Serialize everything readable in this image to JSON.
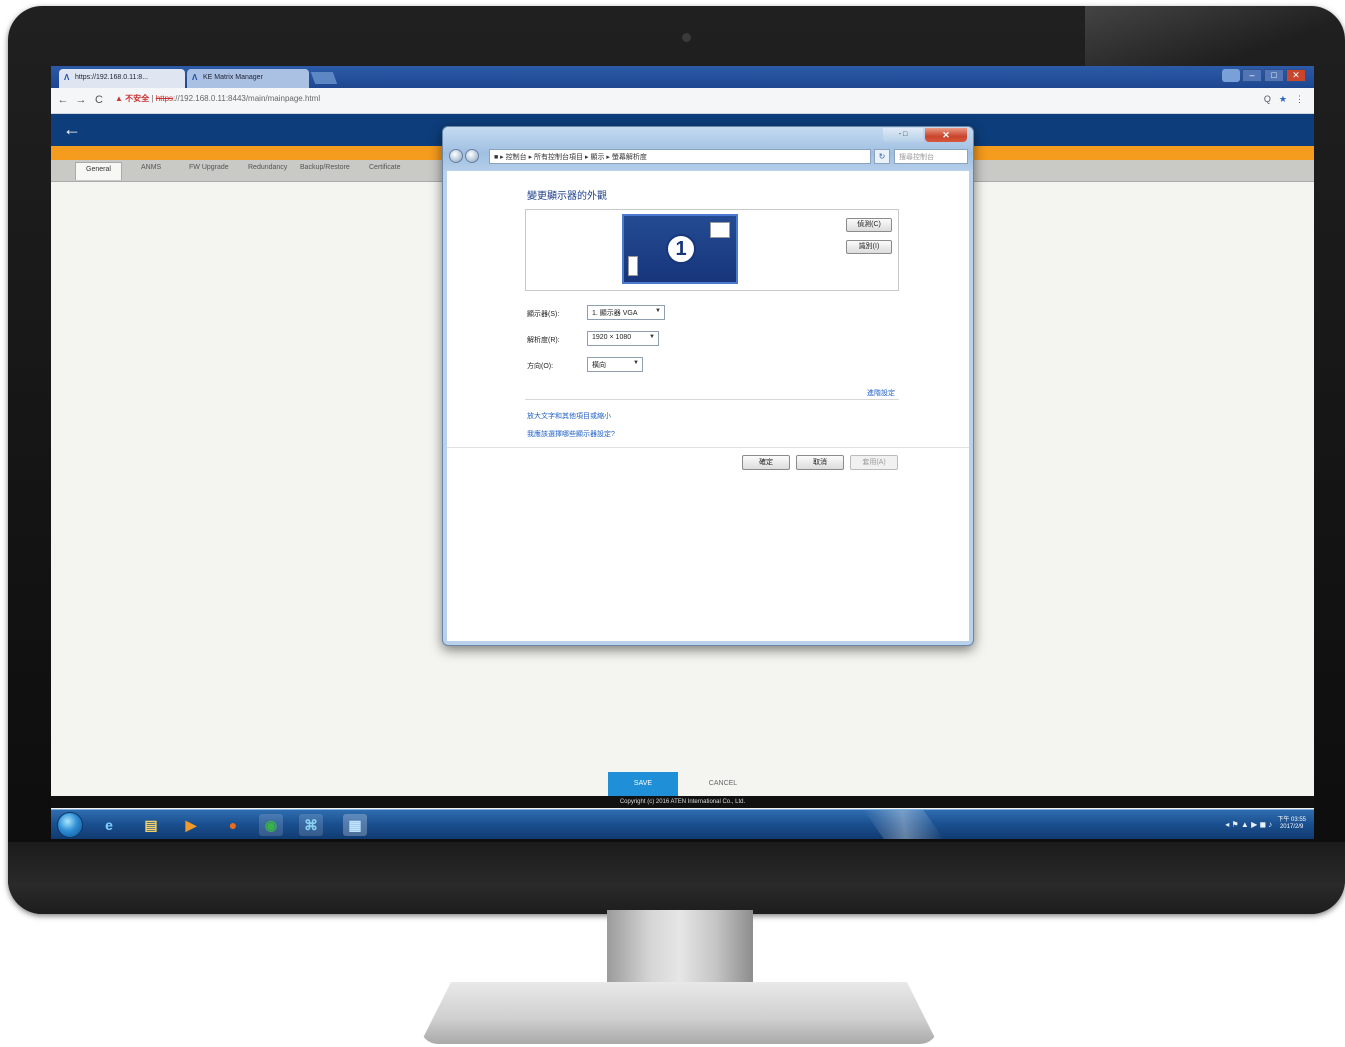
{
  "browser": {
    "tabs": [
      {
        "label": "https://192.168.0.11:8..."
      },
      {
        "label": "KE Matrix Manager"
      }
    ],
    "window_controls": [
      "–",
      "□",
      "✕"
    ],
    "url": {
      "warning_label": "▲ 不安全",
      "scheme": "https",
      "rest": "://192.168.0.11:8443/main/mainpage.html"
    },
    "url_icons": {
      "search": "Q",
      "star": "★",
      "menu": "⋮"
    },
    "nav": {
      "back": "←",
      "forward": "→",
      "reload": "C"
    }
  },
  "app": {
    "back_icon": "←",
    "tabs": [
      "General",
      "ANMS",
      "FW Upgrade",
      "Redundancy",
      "Backup/Restore",
      "Certificate"
    ],
    "save_label": "SAVE",
    "cancel_label": "CANCEL",
    "copyright": "Copyright (c) 2016 ATEN International Co., Ltd."
  },
  "dialog": {
    "window_buttons": {
      "minmax": "-  □",
      "close": "✕"
    },
    "breadcrumb": "■ ▸ 控制台 ▸ 所有控制台項目 ▸ 顯示 ▸ 螢幕解析度",
    "search_placeholder": "搜尋控制台",
    "refresh_icon": "↻",
    "title": "變更顯示器的外觀",
    "display_badge": "1",
    "detect_button": "偵測(C)",
    "identify_button": "識別(I)",
    "fields": [
      {
        "label": "顯示器(S):",
        "value": "1. 顯示器 VGA"
      },
      {
        "label": "解析度(R):",
        "value": "1920 × 1080"
      },
      {
        "label": "方向(O):",
        "value": "橫向"
      }
    ],
    "advanced_link": "進階設定",
    "links": [
      "放大文字和其他項目或縮小",
      "我應該選擇哪些顯示器設定?"
    ],
    "buttons": {
      "ok": "確定",
      "cancel": "取消",
      "apply": "套用(A)"
    }
  },
  "taskbar": {
    "icons": [
      {
        "name": "ie-icon",
        "glyph": "e"
      },
      {
        "name": "explorer-icon",
        "glyph": "▤"
      },
      {
        "name": "media-player-icon",
        "glyph": "▶"
      },
      {
        "name": "firefox-icon",
        "glyph": "●"
      },
      {
        "name": "chrome-icon",
        "glyph": "◉"
      },
      {
        "name": "app-icon",
        "glyph": "⌘"
      },
      {
        "name": "control-panel-icon",
        "glyph": "▦"
      }
    ],
    "tray_icons": "◂ ⚑ ▲ ▶ ◼ ♪",
    "time": "下午 03:55",
    "date": "2017/2/9"
  }
}
